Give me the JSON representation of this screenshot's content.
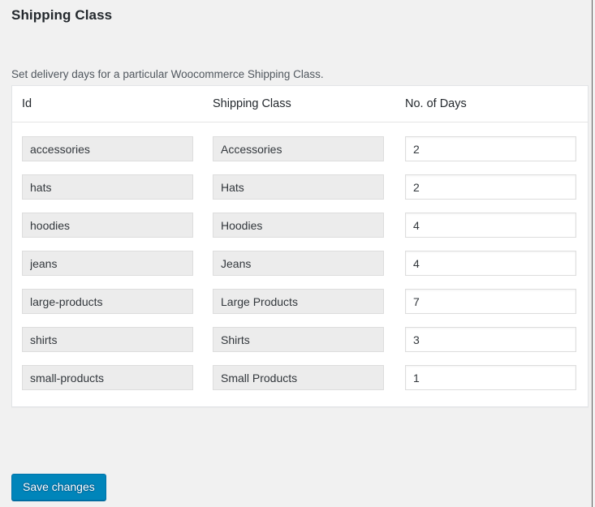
{
  "page": {
    "title": "Shipping Class",
    "description": "Set delivery days for a particular Woocommerce Shipping Class."
  },
  "table": {
    "headers": {
      "id": "Id",
      "shipping_class": "Shipping Class",
      "days": "No. of Days"
    },
    "rows": [
      {
        "id": "accessories",
        "shipping_class": "Accessories",
        "days": "2"
      },
      {
        "id": "hats",
        "shipping_class": "Hats",
        "days": "2"
      },
      {
        "id": "hoodies",
        "shipping_class": "Hoodies",
        "days": "4"
      },
      {
        "id": "jeans",
        "shipping_class": "Jeans",
        "days": "4"
      },
      {
        "id": "large-products",
        "shipping_class": "Large Products",
        "days": "7"
      },
      {
        "id": "shirts",
        "shipping_class": "Shirts",
        "days": "3"
      },
      {
        "id": "small-products",
        "shipping_class": "Small Products",
        "days": "1"
      }
    ]
  },
  "actions": {
    "save_label": "Save changes"
  },
  "colors": {
    "page_background": "#f1f1f1",
    "panel_background": "#ffffff",
    "readonly_field": "#ececec",
    "primary_button": "#0085ba",
    "primary_button_border": "#0073aa",
    "text": "#23282d"
  }
}
